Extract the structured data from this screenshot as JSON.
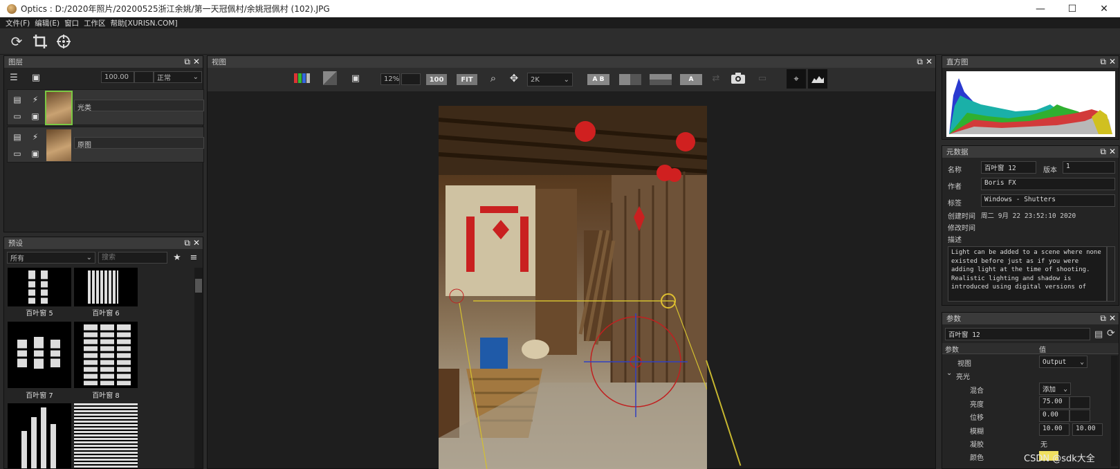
{
  "window": {
    "title": "Optics : D:/2020年照片/20200525浙江余姚/第一天冠佩村/余姚冠佩村 (102).JPG",
    "minimize": "—",
    "maximize": "☐",
    "close": "✕"
  },
  "menu": [
    "文件(F)",
    "编辑(E)",
    "窗口",
    "工作区",
    "帮助[XURISN.COM]"
  ],
  "toolbar_icons": [
    "refresh-icon",
    "crop-icon",
    "compass-icon"
  ],
  "layers_panel": {
    "title": "图层",
    "opacity": "100.00",
    "blend": "正常",
    "layers": [
      {
        "name": "光类",
        "selected": true
      },
      {
        "name": "原图",
        "selected": false
      }
    ]
  },
  "presets_panel": {
    "title": "预设",
    "category": "所有",
    "search_placeholder": "搜索",
    "items": [
      "百叶窗 5",
      "百叶窗 6",
      "百叶窗 7",
      "百叶窗 8"
    ]
  },
  "view_panel": {
    "title": "视图",
    "zoom": "12%",
    "btn_100": "100",
    "btn_fit": "FIT",
    "res": "2K",
    "ab": "A B",
    "a_btn": "A"
  },
  "histogram_panel": {
    "title": "直方图"
  },
  "metadata_panel": {
    "title": "元数据",
    "name_label": "名称",
    "name_value": "百叶窗 12",
    "version_label": "版本",
    "version_value": "1",
    "author_label": "作者",
    "author_value": "Boris FX",
    "tags_label": "标签",
    "tags_value": "Windows - Shutters",
    "created_label": "创建时间",
    "created_value": "周二 9月 22 23:52:10 2020",
    "modified_label": "修改时间",
    "desc_label": "描述",
    "description": "Light can be added to a scene where none existed before just as if you were adding light at the time of shooting. Realistic lighting and shadow is introduced using digital versions of"
  },
  "params_panel": {
    "title": "参数",
    "preset_name": "百叶窗 12",
    "col_param": "参数",
    "col_value": "值",
    "view_label": "视图",
    "view_value": "Output",
    "group": "亮光",
    "blend_label": "混合",
    "blend_value": "添加",
    "brightness_label": "亮度",
    "brightness_value": "75.00",
    "offset_label": "位移",
    "offset_value": "0.00",
    "blur_label": "模糊",
    "blur_value1": "10.00",
    "blur_value2": "10.00",
    "condense_label": "凝胶",
    "condense_value": "无",
    "color_label": "颜色"
  },
  "watermark": "CSDN @sdk大全",
  "colors": {
    "accent_green": "#7ac943",
    "panel_bg": "#242424"
  }
}
